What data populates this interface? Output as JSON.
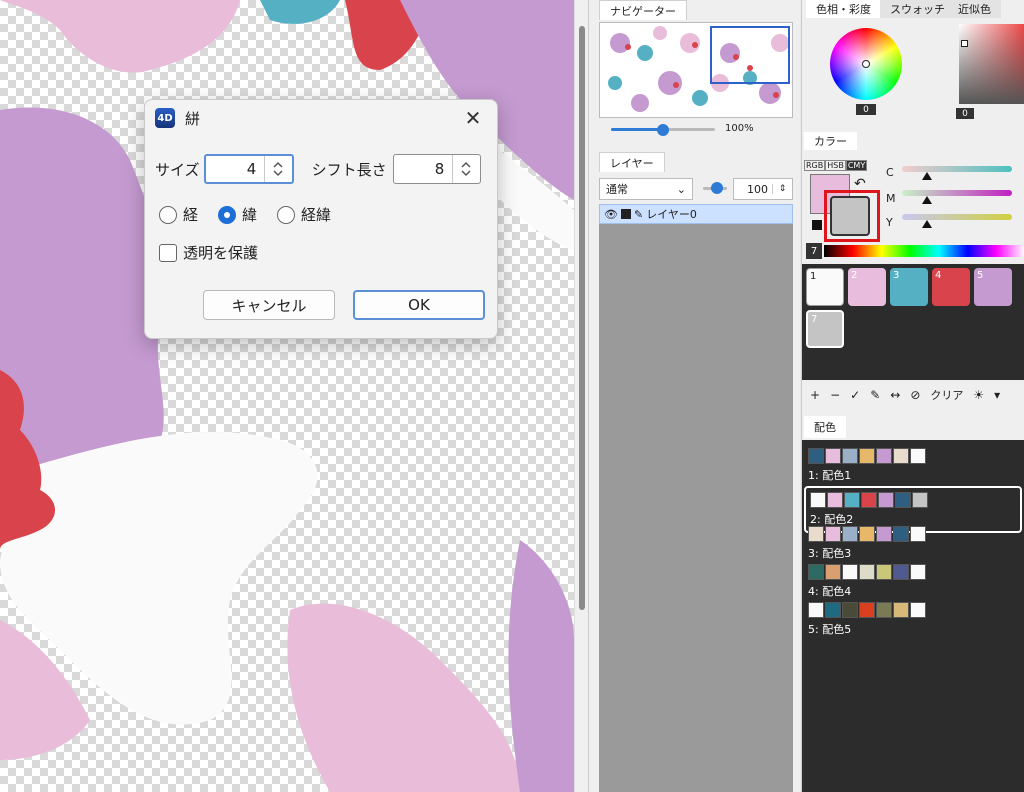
{
  "dialog": {
    "title": "絣",
    "app_icon_text": "4D",
    "size_label": "サイズ",
    "size_value": "4",
    "shift_label": "シフト長さ",
    "shift_value": "8",
    "radio_warp": "経",
    "radio_weft": "緯",
    "radio_both": "経緯",
    "selected_radio": "緯",
    "protect_label": "透明を保護",
    "protect_checked": false,
    "cancel_label": "キャンセル",
    "ok_label": "OK"
  },
  "navigator": {
    "tab": "ナビゲーター",
    "zoom": "100%"
  },
  "layers": {
    "tab": "レイヤー",
    "blend_mode": "通常",
    "opacity": "100",
    "items": [
      {
        "name": "レイヤー0",
        "selected": true
      }
    ]
  },
  "color_panel": {
    "tabs": [
      "色相・彩度",
      "スウォッチ",
      "近似色"
    ],
    "hue_value": "0",
    "sv_value": "0",
    "color_tab": "カラー",
    "modes": [
      "RGB",
      "HSB",
      "CMY"
    ],
    "active_mode": "CMY",
    "sliders": [
      "C",
      "M",
      "Y"
    ],
    "primary_color": "#e8bcdc",
    "secondary_color": "#c4c4c4",
    "index_badge": "7"
  },
  "palette": {
    "entries": [
      {
        "index": "1",
        "color": "#fafafa"
      },
      {
        "index": "2",
        "color": "#e8bcdc"
      },
      {
        "index": "3",
        "color": "#55b0c4"
      },
      {
        "index": "4",
        "color": "#d8434c"
      },
      {
        "index": "5",
        "color": "#c49ad0"
      },
      {
        "index": "7",
        "color": "#c4c4c4"
      }
    ],
    "toolbar": [
      "+",
      "−",
      "✓",
      "✎",
      "↔",
      "⊘",
      "クリア",
      "☀",
      "▾"
    ]
  },
  "schemes": {
    "tab": "配色",
    "items": [
      {
        "name": "1: 配色1",
        "colors": [
          "#2e5e80",
          "#e8bcdc",
          "#9ab0c8",
          "#e8b86a",
          "#c49ad0",
          "#eadccc",
          "#fafafa"
        ]
      },
      {
        "name": "2: 配色2",
        "colors": [
          "#fafafa",
          "#e8bcdc",
          "#55b0c4",
          "#d8434c",
          "#c49ad0",
          "#2e5e80",
          "#c4c4c4"
        ]
      },
      {
        "name": "3: 配色3",
        "colors": [
          "#eadccc",
          "#e8bcdc",
          "#9ab0c8",
          "#e8b86a",
          "#c49ad0",
          "#2e5e80",
          "#fafafa"
        ]
      },
      {
        "name": "4: 配色4",
        "colors": [
          "#2e6a64",
          "#d8a070",
          "#fafafa",
          "#dcdcc8",
          "#c8c878",
          "#505a90",
          "#fafafa"
        ]
      },
      {
        "name": "5: 配色5",
        "colors": [
          "#fafafa",
          "#1e6a80",
          "#4a4a38",
          "#d84020",
          "#7a7a54",
          "#d8b878",
          "#fafafa"
        ]
      }
    ]
  }
}
